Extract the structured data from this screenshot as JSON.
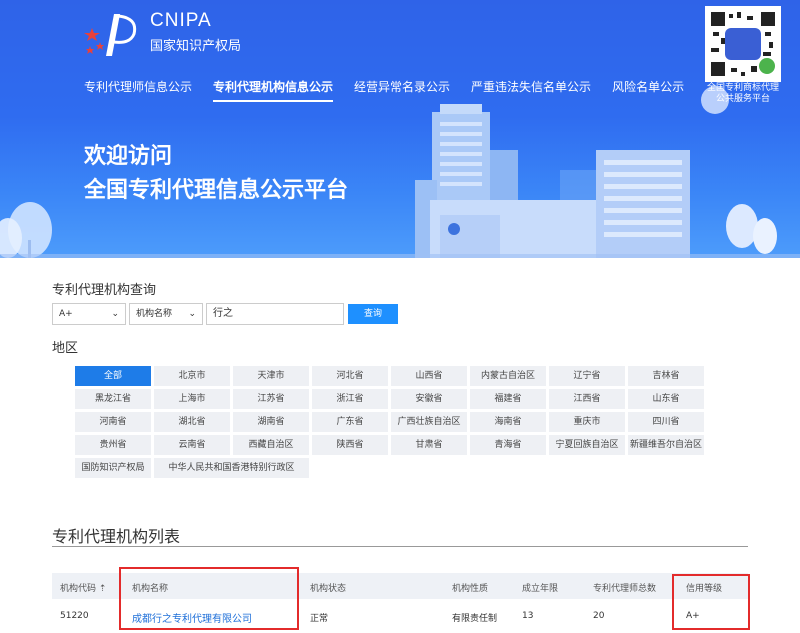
{
  "header": {
    "brand_en": "CNIPA",
    "brand_cn": "国家知识产权局",
    "nav": [
      {
        "label": "专利代理师信息公示",
        "active": false
      },
      {
        "label": "专利代理机构信息公示",
        "active": true
      },
      {
        "label": "经营异常名录公示",
        "active": false
      },
      {
        "label": "严重违法失信名单公示",
        "active": false
      },
      {
        "label": "风险名单公示",
        "active": false
      }
    ],
    "qr_label_1": "全国专利商标代理",
    "qr_label_2": "公共服务平台",
    "welcome_1": "欢迎访问",
    "welcome_2": "全国专利代理信息公示平台"
  },
  "query": {
    "title": "专利代理机构查询",
    "grade_select": "A+",
    "field_select": "机构名称",
    "keyword": "行之",
    "search_label": "查询"
  },
  "regions": {
    "title": "地区",
    "items": [
      "全部",
      "北京市",
      "天津市",
      "河北省",
      "山西省",
      "内蒙古自治区",
      "辽宁省",
      "吉林省",
      "黑龙江省",
      "上海市",
      "江苏省",
      "浙江省",
      "安徽省",
      "福建省",
      "江西省",
      "山东省",
      "河南省",
      "湖北省",
      "湖南省",
      "广东省",
      "广西壮族自治区",
      "海南省",
      "重庆市",
      "四川省",
      "贵州省",
      "云南省",
      "西藏自治区",
      "陕西省",
      "甘肃省",
      "青海省",
      "宁夏回族自治区",
      "新疆维吾尔自治区",
      "国防知识产权局",
      "中华人民共和国香港特别行政区"
    ],
    "active": "全部"
  },
  "list": {
    "title": "专利代理机构列表",
    "columns": [
      "机构代码 ⇡",
      "机构名称",
      "机构状态",
      "机构性质",
      "成立年限",
      "专利代理师总数",
      "信用等级"
    ],
    "rows": [
      [
        "51220",
        "成都行之专利代理有限公司",
        "正常",
        "有限责任制",
        "13",
        "20",
        "A+"
      ]
    ]
  },
  "colors": {
    "banner": "#2f63e8",
    "accent": "#1e7ce8",
    "highlight_box": "#e32b2b",
    "link": "#1e6fd9"
  }
}
